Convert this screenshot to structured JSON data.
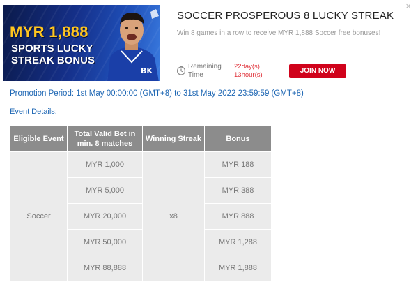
{
  "dialog": {
    "close_icon": "close-icon",
    "close_glyph": "×"
  },
  "banner": {
    "amount": "MYR 1,888",
    "subtitle_line1": "SPORTS LUCKY",
    "subtitle_line2": "STREAK BONUS"
  },
  "promo": {
    "title": "SOCCER PROSPEROUS 8 LUCKY STREAK",
    "description": "Win 8 games in a row to receive MYR 1,888 Soccer free bonuses!",
    "remaining_line1": "Remaining",
    "remaining_line2": "Time",
    "days": "22day(s)",
    "hours": "13hour(s)",
    "join_label": "JOIN NOW",
    "accent_color": "#d0021b"
  },
  "period": "Promotion Period: 1st May 00:00:00 (GMT+8) to 31st May 2022 23:59:59 (GMT+8)",
  "details_label": "Event Details:",
  "table": {
    "headers": [
      "Eligible Event",
      "Total Valid Bet in min. 8 matches",
      "Winning Streak",
      "Bonus"
    ],
    "event": "Soccer",
    "streak": "x8",
    "rows": [
      {
        "bet": "MYR 1,000",
        "bonus": "MYR 188"
      },
      {
        "bet": "MYR 5,000",
        "bonus": "MYR 388"
      },
      {
        "bet": "MYR 20,000",
        "bonus": "MYR 888"
      },
      {
        "bet": "MYR 50,000",
        "bonus": "MYR 1,288"
      },
      {
        "bet": "MYR 88,888",
        "bonus": "MYR 1,888"
      }
    ]
  }
}
